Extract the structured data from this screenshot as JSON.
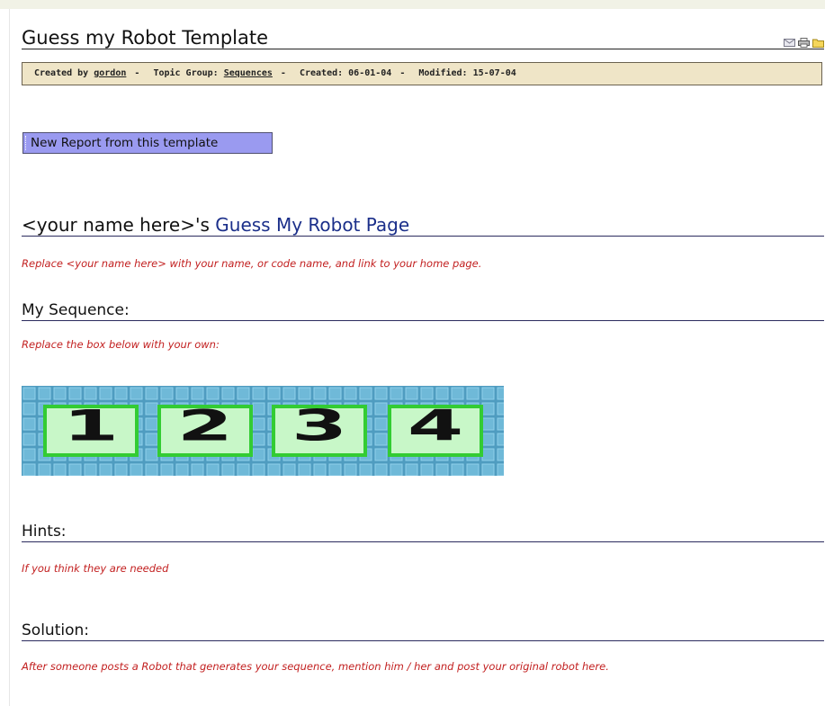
{
  "page": {
    "title": "Guess my Robot Template",
    "title_icons": [
      "mail-icon",
      "print-icon",
      "folder-icon"
    ]
  },
  "meta": {
    "created_by_label": "Created by",
    "author": "gordon",
    "topic_group_label": "Topic Group:",
    "topic_group": "Sequences",
    "created_label": "Created: 06-01-04",
    "modified_label": "Modified: 15-07-04",
    "separator": "-"
  },
  "actions": {
    "new_report_label": "New Report from this template"
  },
  "content": {
    "heading_name": "<your name here>'s",
    "heading_rest": " Guess My Robot Page",
    "heading_note": "Replace <your name here> with your name, or code name, and link to your home page.",
    "sequence_heading": "My Sequence:",
    "sequence_note": "Replace the box below with your own:",
    "sequence_tiles": [
      "1",
      "2",
      "3",
      "4"
    ],
    "hints_heading": "Hints:",
    "hints_note": "If you think they are needed",
    "solution_heading": "Solution:",
    "solution_note": "After someone posts a Robot that generates your sequence, mention him / her and post your original robot here."
  },
  "colors": {
    "meta_bar": "#efe5c7",
    "button": "#9a9af0",
    "note_text": "#c21f1f",
    "heading_accent": "#1b2f8a",
    "tile_grid": "#5fa9c9",
    "tile_face": "#c8f7c8",
    "tile_border": "#33cc33"
  }
}
